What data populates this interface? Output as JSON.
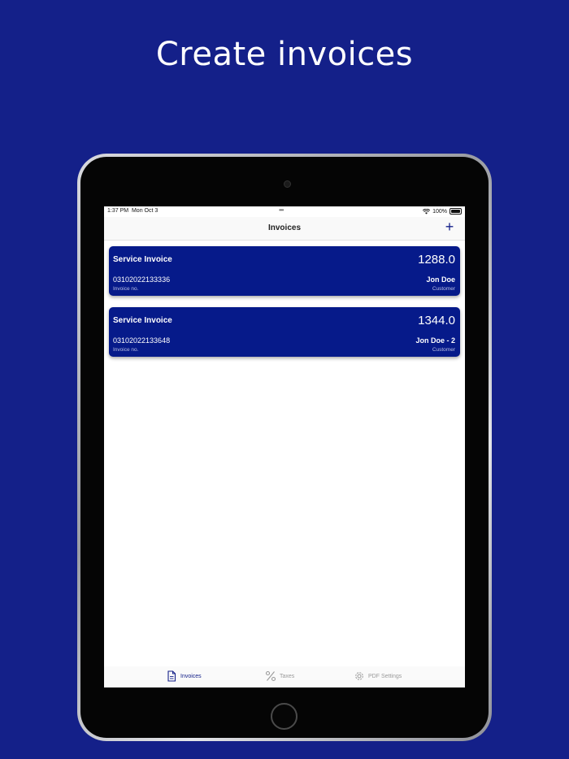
{
  "headline": "Create invoices",
  "status_bar": {
    "time": "1:37 PM",
    "date": "Mon Oct 3",
    "dots": "•••",
    "battery": "100%"
  },
  "nav": {
    "title": "Invoices",
    "add_label": "+"
  },
  "invoices": [
    {
      "title": "Service Invoice",
      "amount": "1288.0",
      "number": "03102022133336",
      "number_label": "Invoice no.",
      "customer": "Jon Doe",
      "customer_label": "Customer"
    },
    {
      "title": "Service Invoice",
      "amount": "1344.0",
      "number": "03102022133648",
      "number_label": "Invoice no.",
      "customer": "Jon Doe - 2",
      "customer_label": "Customer"
    }
  ],
  "tabs": [
    {
      "label": "Invoices",
      "icon": "document-icon",
      "active": true
    },
    {
      "label": "Taxes",
      "icon": "percent-icon",
      "active": false
    },
    {
      "label": "PDF Settings",
      "icon": "gear-icon",
      "active": false
    }
  ],
  "colors": {
    "background": "#142089",
    "card": "#061a8a",
    "accent": "#142089"
  }
}
